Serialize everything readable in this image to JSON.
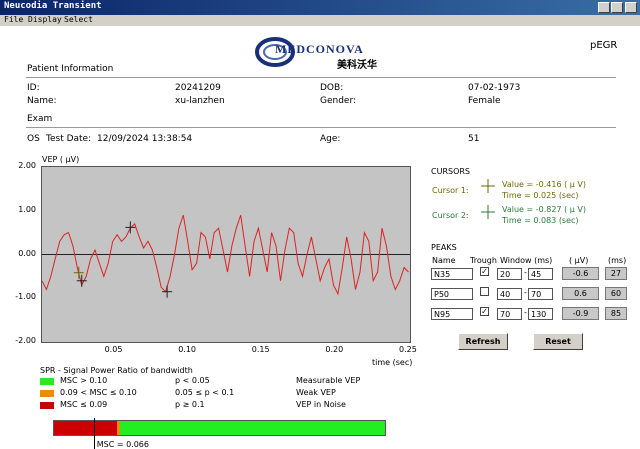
{
  "window": {
    "title": "Neucodia Transient"
  },
  "menu": [
    "File",
    "Display",
    "Select"
  ],
  "logo": {
    "text": "MEDCONOVA",
    "subtext": "美科沃华"
  },
  "mode": "pEGR",
  "patient": {
    "header": "Patient Information",
    "id_label": "ID:",
    "id_value": "20241209",
    "name_label": "Name:",
    "name_value": "xu-lanzhen",
    "dob_label": "DOB:",
    "dob_value": "07-02-1973",
    "gender_label": "Gender:",
    "gender_value": "Female"
  },
  "exam": {
    "header": "Exam",
    "eye": "OS",
    "test_date_label": "Test Date:",
    "test_date_value": "12/09/2024 13:38:54",
    "age_label": "Age:",
    "age_value": "51"
  },
  "chart_data": {
    "type": "line",
    "ylabel": "VEP ( µV)",
    "xlabel": "time (sec)",
    "xlim": [
      0,
      0.25
    ],
    "ylim": [
      -2.0,
      2.0
    ],
    "x_ticks": [
      "0.05",
      "0.10",
      "0.15",
      "0.20",
      "0.25"
    ],
    "y_ticks": [
      "2.00",
      "1.00",
      "0.00",
      "-1.00",
      "-2.00"
    ],
    "line_color": "#dd2222",
    "series": [
      {
        "x": [
          0,
          0.003,
          0.006,
          0.009,
          0.012,
          0.015,
          0.018,
          0.021,
          0.024,
          0.027,
          0.03,
          0.033,
          0.036,
          0.039,
          0.042,
          0.045,
          0.048,
          0.051,
          0.054,
          0.057,
          0.06,
          0.063,
          0.066,
          0.069,
          0.072,
          0.075,
          0.078,
          0.081,
          0.084,
          0.087,
          0.09,
          0.093,
          0.096,
          0.099,
          0.102,
          0.105,
          0.108,
          0.111,
          0.114,
          0.117,
          0.12,
          0.123,
          0.126,
          0.129,
          0.132,
          0.135,
          0.138,
          0.141,
          0.144,
          0.147,
          0.15,
          0.153,
          0.156,
          0.159,
          0.162,
          0.165,
          0.168,
          0.171,
          0.174,
          0.177,
          0.18,
          0.183,
          0.186,
          0.189,
          0.192,
          0.195,
          0.198,
          0.201,
          0.204,
          0.207,
          0.21,
          0.213,
          0.216,
          0.219,
          0.222,
          0.225,
          0.228,
          0.231,
          0.234,
          0.237,
          0.24,
          0.243,
          0.246,
          0.249
        ],
        "y": [
          -0.6,
          -0.8,
          -0.5,
          -0.1,
          0.3,
          0.45,
          0.5,
          0.2,
          -0.3,
          -0.7,
          -0.5,
          -0.1,
          0.1,
          -0.2,
          -0.5,
          -0.2,
          0.3,
          0.45,
          0.3,
          0.4,
          0.6,
          0.7,
          0.4,
          0.15,
          0.3,
          0.1,
          -0.3,
          -0.75,
          -0.85,
          -0.5,
          0.0,
          0.6,
          0.9,
          0.3,
          -0.35,
          -0.2,
          0.5,
          0.4,
          -0.1,
          0.5,
          0.6,
          0.1,
          -0.4,
          0.2,
          0.6,
          0.9,
          0.2,
          -0.5,
          0.3,
          0.6,
          0.1,
          -0.4,
          0.5,
          0.2,
          -0.6,
          0.1,
          0.6,
          0.5,
          -0.2,
          -0.5,
          0.0,
          0.4,
          -0.1,
          -0.6,
          -0.3,
          -0.1,
          -0.7,
          -0.9,
          -0.3,
          0.4,
          -0.1,
          -0.8,
          -0.4,
          0.5,
          0.3,
          -0.6,
          -0.4,
          0.6,
          0.2,
          -0.5,
          -0.8,
          -0.6,
          -0.3,
          -0.4
        ]
      }
    ],
    "markers": [
      {
        "name": "N35",
        "x": 0.027,
        "y": -0.6
      },
      {
        "name": "P50",
        "x": 0.06,
        "y": 0.62
      },
      {
        "name": "N95",
        "x": 0.085,
        "y": -0.85
      },
      {
        "name": "cursor1",
        "x": 0.025,
        "y": -0.416
      }
    ]
  },
  "cursors": {
    "header": "CURSORS",
    "c1_label": "Cursor 1:",
    "c1_value": "Value = -0.416 ( µ V)",
    "c1_time": "Time = 0.025 (sec)",
    "c1_color": "#6b6b00",
    "c2_label": "Cursor 2:",
    "c2_value": "Value = -0.827 ( µ V)",
    "c2_time": "Time = 0.083 (sec)",
    "c2_color": "#2a7a3a"
  },
  "peaks": {
    "header": "PEAKS",
    "col_name": "Name",
    "col_trough": "Trough",
    "col_window": "Window (ms)",
    "col_uv": "( µV)",
    "col_ms": "(ms)",
    "rows": [
      {
        "name": "N35",
        "trough": true,
        "w1": "20",
        "w2": "45",
        "uv": "-0.6",
        "ms": "27"
      },
      {
        "name": "P50",
        "trough": false,
        "w1": "40",
        "w2": "70",
        "uv": "0.6",
        "ms": "60"
      },
      {
        "name": "N95",
        "trough": true,
        "w1": "70",
        "w2": "130",
        "uv": "-0.9",
        "ms": "85"
      }
    ],
    "dash": "-"
  },
  "buttons": {
    "refresh": "Refresh",
    "reset": "Reset"
  },
  "spr": {
    "title": "SPR - Signal Power Ratio of bandwidth",
    "rows": [
      {
        "color": "#22ee22",
        "range": "MSC > 0.10",
        "p": "p < 0.05",
        "desc": "Measurable VEP"
      },
      {
        "color": "#f08a00",
        "range": "0.09 < MSC ≤ 0.10",
        "p": "0.05 ≤ p < 0.1",
        "desc": "Weak VEP"
      },
      {
        "color": "#cc0000",
        "range": "MSC ≤ 0.09",
        "p": "p ≥ 0.1",
        "desc": "VEP in Noise"
      }
    ],
    "bar": {
      "red_frac": 0.19,
      "orange_frac": 0.01,
      "green_frac": 0.8,
      "msc_label": "MSC = 0.066",
      "msc_frac": 0.12
    }
  }
}
